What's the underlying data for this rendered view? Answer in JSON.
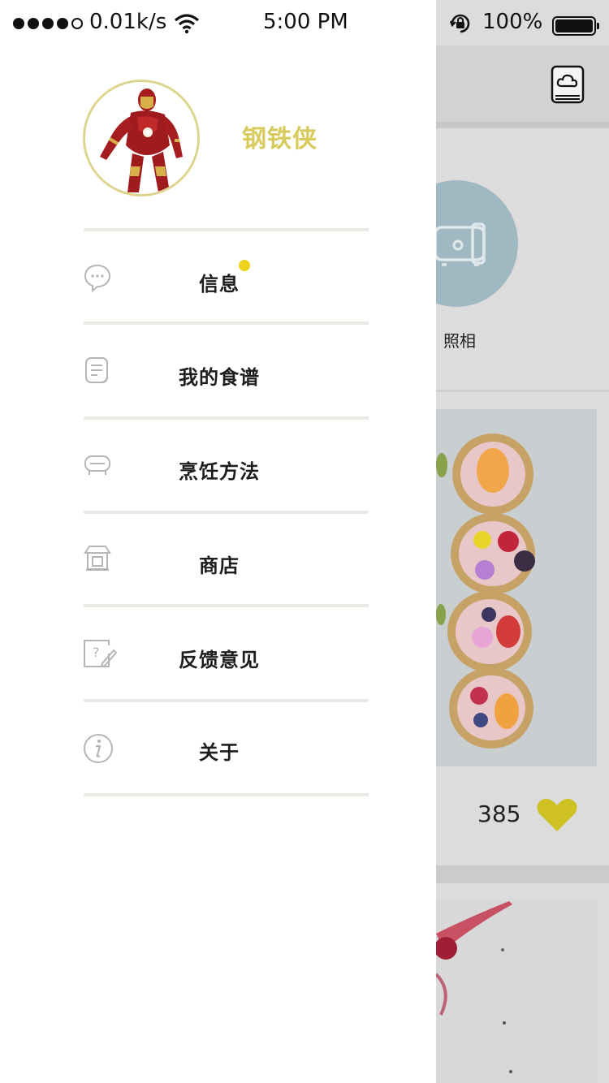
{
  "status_bar": {
    "network_speed": "0.01k/s",
    "time": "5:00 PM",
    "battery": "100%"
  },
  "profile": {
    "name": "钢铁侠"
  },
  "menu": {
    "items": [
      {
        "label": "信息",
        "icon": "chat-bubble-icon",
        "has_badge": true
      },
      {
        "label": "我的食谱",
        "icon": "recipe-document-icon",
        "has_badge": false
      },
      {
        "label": "烹饪方法",
        "icon": "cooking-pot-icon",
        "has_badge": false
      },
      {
        "label": "商店",
        "icon": "store-icon",
        "has_badge": false
      },
      {
        "label": "反馈意见",
        "icon": "feedback-icon",
        "has_badge": false
      },
      {
        "label": "关于",
        "icon": "info-icon",
        "has_badge": false
      }
    ]
  },
  "background": {
    "camera_label": "照相",
    "likes_count": "385",
    "accent_color": "#d4c21e",
    "brand_color": "#d7cb5d",
    "badge_color": "#eed31d"
  }
}
